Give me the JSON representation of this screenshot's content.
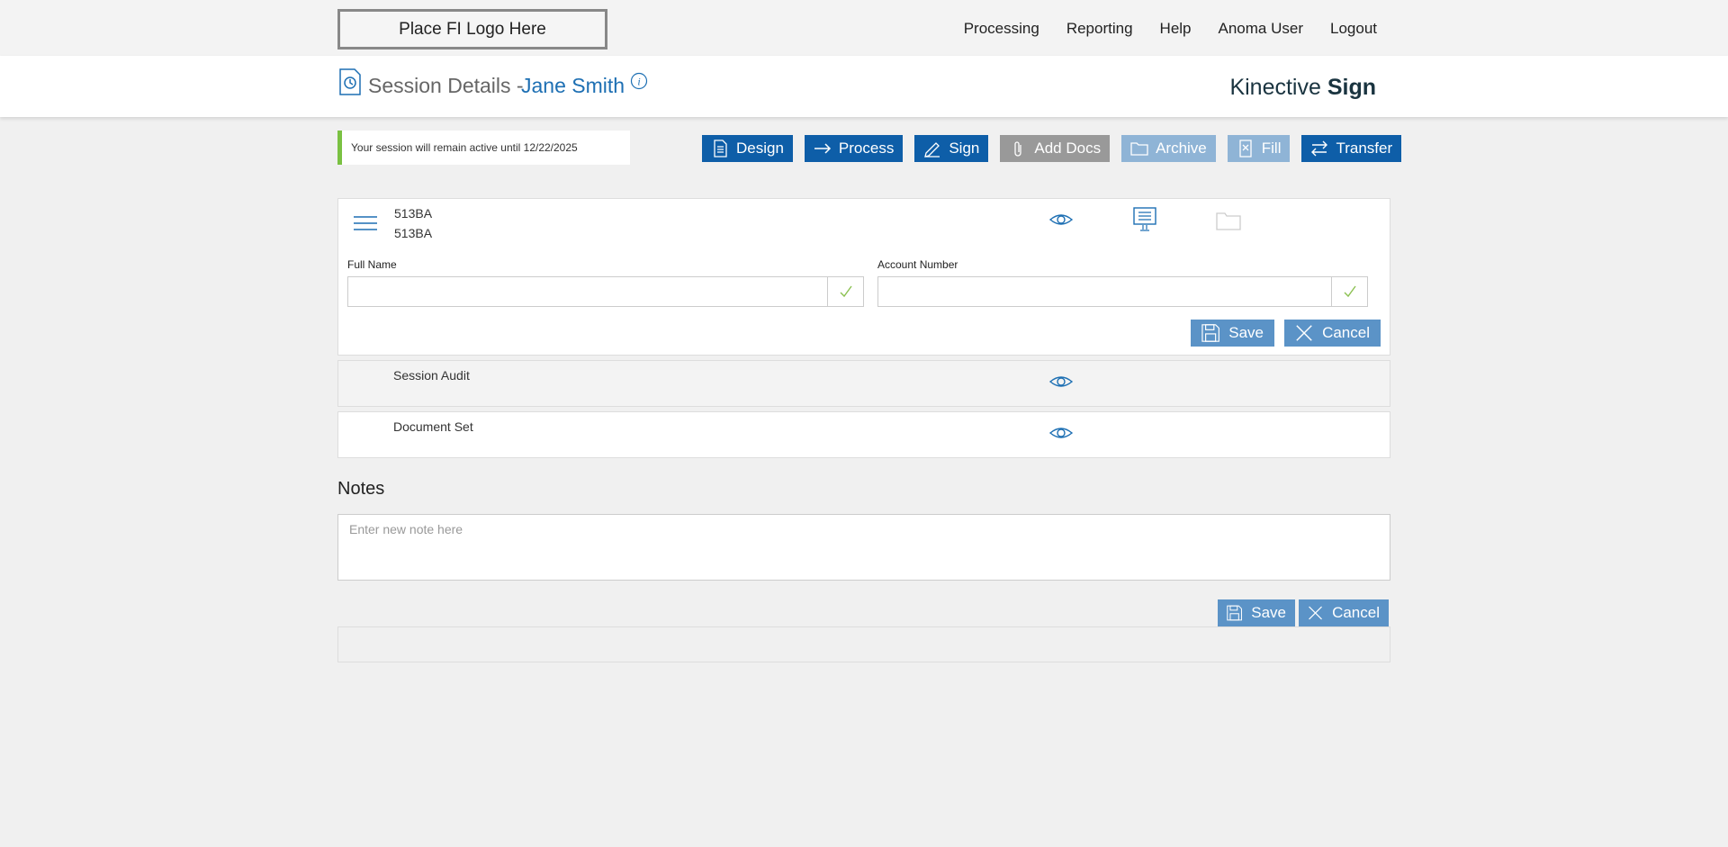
{
  "topbar": {
    "logo_text": "Place FI Logo Here",
    "nav": [
      "Processing",
      "Reporting",
      "Help",
      "Anoma User",
      "Logout"
    ]
  },
  "header": {
    "title": "Session Details -",
    "name": "Jane Smith",
    "brand_light": "Kinective ",
    "brand_bold": "Sign"
  },
  "banner": {
    "text": "Your session will remain active until 12/22/2025"
  },
  "actions": [
    {
      "label": "Design",
      "icon": "document-list-icon",
      "state": "active"
    },
    {
      "label": "Process",
      "icon": "arrow-right-icon",
      "state": "active"
    },
    {
      "label": "Sign",
      "icon": "pen-icon",
      "state": "active"
    },
    {
      "label": "Add Docs",
      "icon": "paperclip-icon",
      "state": "disabled-grey"
    },
    {
      "label": "Archive",
      "icon": "folder-icon",
      "state": "disabled"
    },
    {
      "label": "Fill",
      "icon": "form-x-icon",
      "state": "disabled"
    },
    {
      "label": "Transfer",
      "icon": "swap-arrows-icon",
      "state": "active"
    }
  ],
  "record": {
    "id_line1": "513BA",
    "id_line2": "513BA",
    "full_name_label": "Full Name",
    "full_name_value": "",
    "account_label": "Account Number",
    "account_value": "",
    "save_label": "Save",
    "cancel_label": "Cancel"
  },
  "rows": {
    "audit_label": "Session Audit",
    "docset_label": "Document Set"
  },
  "notes": {
    "heading": "Notes",
    "placeholder": "Enter new note here",
    "save_label": "Save",
    "cancel_label": "Cancel"
  },
  "colors": {
    "primary": "#0e5ea8",
    "link": "#1d6fb3",
    "secondary_button": "#5b93c7",
    "disabled_button": "#8fb4d6",
    "grey_button": "#999999",
    "banner_accent": "#7ac142",
    "check": "#8cc152"
  }
}
